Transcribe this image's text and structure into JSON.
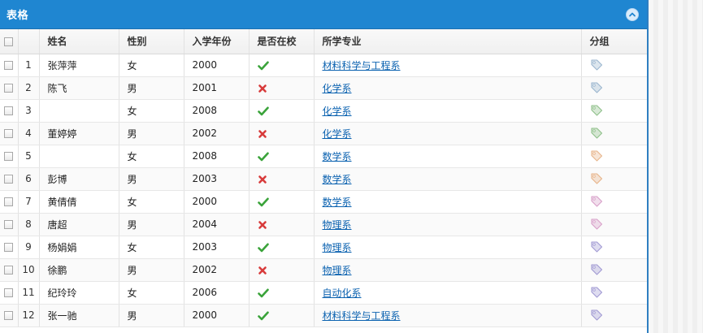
{
  "panel": {
    "title": "表格"
  },
  "columns": {
    "name": "姓名",
    "gender": "性别",
    "year": "入学年份",
    "in_school": "是否在校",
    "major": "所学专业",
    "group": "分组"
  },
  "rows": [
    {
      "num": "1",
      "name": "张萍萍",
      "gender": "女",
      "year": "2000",
      "in_school": true,
      "major": "材料科学与工程系",
      "tag_color": "#9bb6cf"
    },
    {
      "num": "2",
      "name": "陈飞",
      "gender": "男",
      "year": "2001",
      "in_school": false,
      "major": "化学系",
      "tag_color": "#9bb6cf"
    },
    {
      "num": "3",
      "name": "",
      "gender": "女",
      "year": "2008",
      "in_school": true,
      "major": "化学系",
      "tag_color": "#8fc08a"
    },
    {
      "num": "4",
      "name": "董婷婷",
      "gender": "男",
      "year": "2002",
      "in_school": false,
      "major": "化学系",
      "tag_color": "#8fc08a"
    },
    {
      "num": "5",
      "name": "",
      "gender": "女",
      "year": "2008",
      "in_school": true,
      "major": "数学系",
      "tag_color": "#e7b48a"
    },
    {
      "num": "6",
      "name": "彭博",
      "gender": "男",
      "year": "2003",
      "in_school": false,
      "major": "数学系",
      "tag_color": "#e7b48a"
    },
    {
      "num": "7",
      "name": "黄倩倩",
      "gender": "女",
      "year": "2000",
      "in_school": true,
      "major": "数学系",
      "tag_color": "#d8a0c9"
    },
    {
      "num": "8",
      "name": "唐超",
      "gender": "男",
      "year": "2004",
      "in_school": false,
      "major": "物理系",
      "tag_color": "#d8a0c9"
    },
    {
      "num": "9",
      "name": "杨娟娟",
      "gender": "女",
      "year": "2003",
      "in_school": true,
      "major": "物理系",
      "tag_color": "#a19ad3"
    },
    {
      "num": "10",
      "name": "徐鹏",
      "gender": "男",
      "year": "2002",
      "in_school": false,
      "major": "物理系",
      "tag_color": "#a19ad3"
    },
    {
      "num": "11",
      "name": "纪玲玲",
      "gender": "女",
      "year": "2006",
      "in_school": true,
      "major": "自动化系",
      "tag_color": "#a19ad3"
    },
    {
      "num": "12",
      "name": "张一驰",
      "gender": "男",
      "year": "2000",
      "in_school": true,
      "major": "材料科学与工程系",
      "tag_color": "#a19ad3"
    }
  ],
  "colors": {
    "header_blue": "#1f86d1",
    "check_green": "#3aa33a",
    "cross_red": "#d83b3b",
    "link_blue": "#0b62b0"
  },
  "icons": {
    "collapse": "chevron-up-icon",
    "in_school_true": "check-icon",
    "in_school_false": "cross-icon",
    "group": "tag-icon"
  }
}
